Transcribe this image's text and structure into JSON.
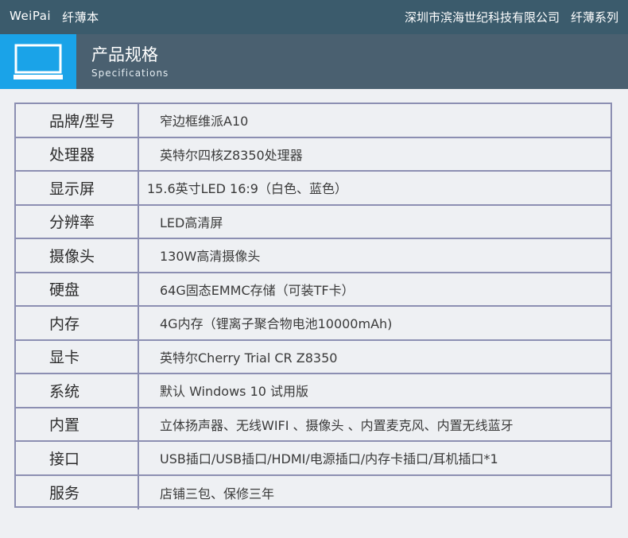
{
  "topbar": {
    "brand": "WeiPai",
    "product": "纤薄本",
    "company": "深圳市滨海世纪科技有限公司",
    "series": "纤薄系列"
  },
  "header": {
    "icon": "laptop-icon",
    "title": "产品规格",
    "subtitle": "Specifications",
    "accent_color": "#1aa3e8",
    "bar_color": "#4a6070"
  },
  "specs": [
    {
      "label": "品牌/型号",
      "value": "窄边框维派A10"
    },
    {
      "label": "处理器",
      "value": "英特尔四核Z8350处理器"
    },
    {
      "label": "显示屏",
      "value": "15.6英寸LED 16:9（白色、蓝色）"
    },
    {
      "label": "分辨率",
      "value": "LED高清屏"
    },
    {
      "label": "摄像头",
      "value": "130W高清摄像头"
    },
    {
      "label": "硬盘",
      "value": "64G固态EMMC存储（可装TF卡）"
    },
    {
      "label": "内存",
      "value": "4G内存（锂离子聚合物电池10000mAh)"
    },
    {
      "label": "显卡",
      "value": "英特尔Cherry Trial CR Z8350"
    },
    {
      "label": "系统",
      "value": "默认 Windows 10 试用版"
    },
    {
      "label": "内置",
      "value": "立体扬声器、无线WIFI 、摄像头 、内置麦克风、内置无线蓝牙"
    },
    {
      "label": "接口",
      "value": "USB插口/USB插口/HDMI/电源插口/内存卡插口/耳机插口*1"
    },
    {
      "label": "服务",
      "value": "店铺三包、保修三年"
    }
  ]
}
